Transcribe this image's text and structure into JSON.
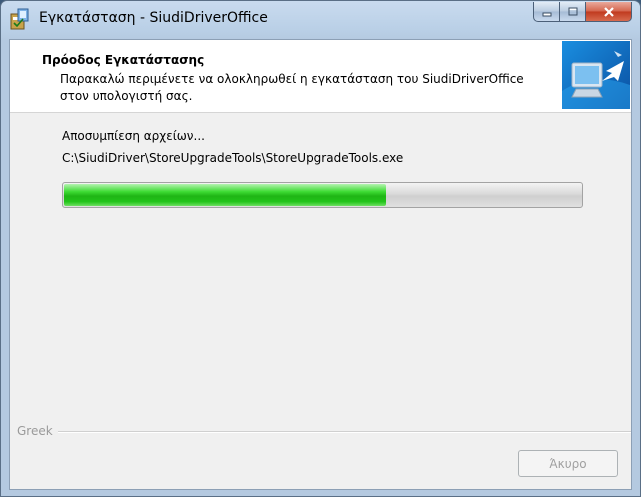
{
  "window": {
    "title": "Εγκατάσταση - SiudiDriverOffice",
    "icon": "installer-icon"
  },
  "header": {
    "title": "Πρόοδος Εγκατάστασης",
    "subtitle": "Παρακαλώ περιμένετε να ολοκληρωθεί η εγκατάσταση του SiudiDriverOffice στον υπολογιστή σας.",
    "image": "computer-install-icon"
  },
  "status": {
    "label": "Αποσυμπίεση αρχείων...",
    "file": "C:\\SiudiDriver\\StoreUpgradeTools\\StoreUpgradeTools.exe"
  },
  "progress": {
    "fraction": 0.62,
    "color": "#22c41a"
  },
  "footer": {
    "group_label": "Greek",
    "cancel_label": "Άκυρο",
    "cancel_enabled": false
  },
  "colors": {
    "title_bar": "#b9cfe6",
    "close_button": "#c0391e",
    "client_bg": "#f0f0f0"
  }
}
